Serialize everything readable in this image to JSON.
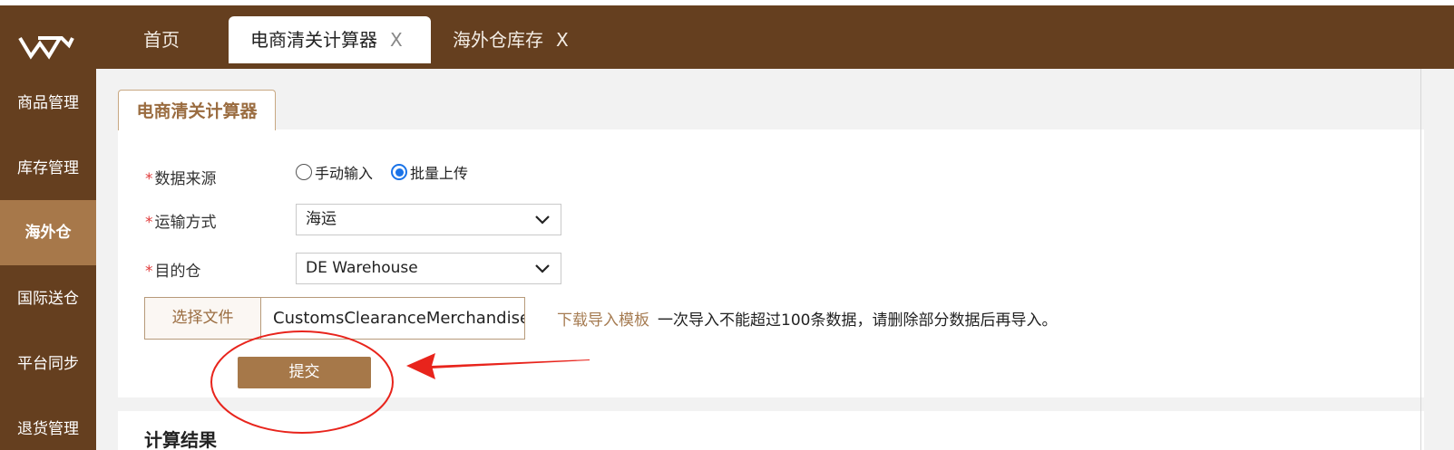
{
  "header": {
    "tabs": [
      {
        "label": "首页",
        "closable": false,
        "active": false
      },
      {
        "label": "电商清关计算器",
        "closable": true,
        "active": true
      },
      {
        "label": "海外仓库存",
        "closable": true,
        "active": false
      }
    ],
    "close_glyph": "X"
  },
  "sidebar": {
    "items": [
      {
        "label": "商品管理",
        "active": false
      },
      {
        "label": "库存管理",
        "active": false
      },
      {
        "label": "海外仓",
        "active": true
      },
      {
        "label": "国际送仓",
        "active": false
      },
      {
        "label": "平台同步",
        "active": false
      },
      {
        "label": "退货管理",
        "active": false
      }
    ]
  },
  "panel": {
    "title": "电商清关计算器",
    "required_mark": "*",
    "fields": {
      "data_source": {
        "label": "数据来源",
        "options": [
          "手动输入",
          "批量上传"
        ],
        "selected": "批量上传"
      },
      "shipping_method": {
        "label": "运输方式",
        "value": "海运"
      },
      "destination": {
        "label": "目的仓",
        "value": "DE Warehouse"
      }
    },
    "file": {
      "button_label": "选择文件",
      "file_name": "CustomsClearanceMerchandise.x"
    },
    "download_link": "下载导入模板",
    "hint": "一次导入不能超过100条数据，请删除部分数据后再导入。",
    "submit_label": "提交"
  },
  "results": {
    "title": "计算结果"
  },
  "colors": {
    "brand_dark": "#653f1f",
    "brand_accent": "#a67849",
    "required": "#e03b3b",
    "annotation": "#e8241c",
    "radio_selected": "#1a73e8"
  },
  "icons": [
    "logo-icon",
    "close-icon",
    "chevron-down-icon"
  ]
}
